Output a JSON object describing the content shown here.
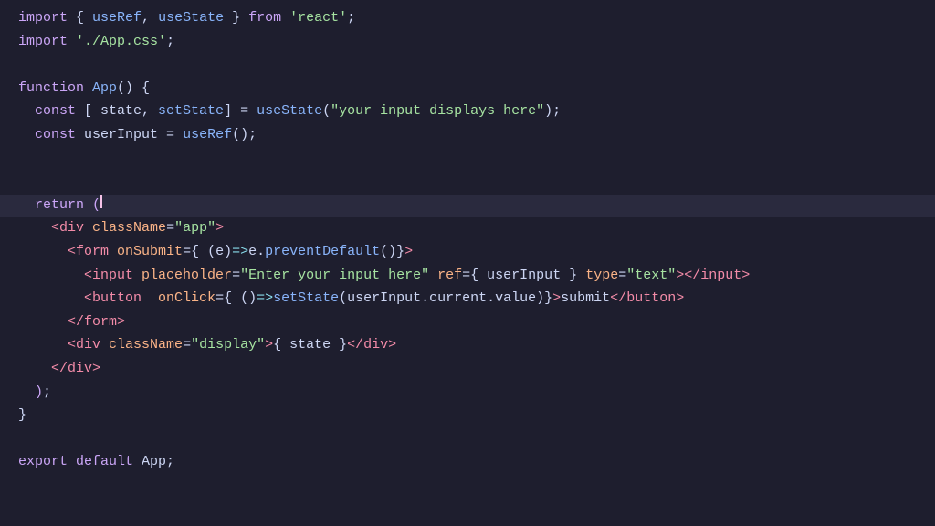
{
  "editor": {
    "background": "#1e1e2e",
    "lines": [
      {
        "id": "line-1",
        "content": "import { useRef, useState } from 'react';"
      },
      {
        "id": "line-2",
        "content": "import './App.css';"
      },
      {
        "id": "line-3",
        "content": ""
      },
      {
        "id": "line-4",
        "content": "function App() {"
      },
      {
        "id": "line-5",
        "content": "  const [ state, setState] = useState(\"your input displays here\");"
      },
      {
        "id": "line-6",
        "content": "  const userInput = useRef();"
      },
      {
        "id": "line-7",
        "content": ""
      },
      {
        "id": "line-8",
        "content": ""
      },
      {
        "id": "line-9",
        "content": "  return ("
      },
      {
        "id": "line-10",
        "content": "    <div className=\"app\">"
      },
      {
        "id": "line-11",
        "content": "      <form onSubmit={ (e)=>e.preventDefault()}>"
      },
      {
        "id": "line-12",
        "content": "        <input placeholder=\"Enter your input here\" ref={ userInput } type=\"text\"></input>"
      },
      {
        "id": "line-13",
        "content": "        <button  onClick={ ()=>setState(userInput.current.value)}>submit</button>"
      },
      {
        "id": "line-14",
        "content": "      </form>"
      },
      {
        "id": "line-15",
        "content": "      <div className=\"display\">{ state }</div>"
      },
      {
        "id": "line-16",
        "content": "    </div>"
      },
      {
        "id": "line-17",
        "content": "  );"
      },
      {
        "id": "line-18",
        "content": "}"
      },
      {
        "id": "line-19",
        "content": ""
      },
      {
        "id": "line-20",
        "content": "export default App;"
      }
    ]
  }
}
